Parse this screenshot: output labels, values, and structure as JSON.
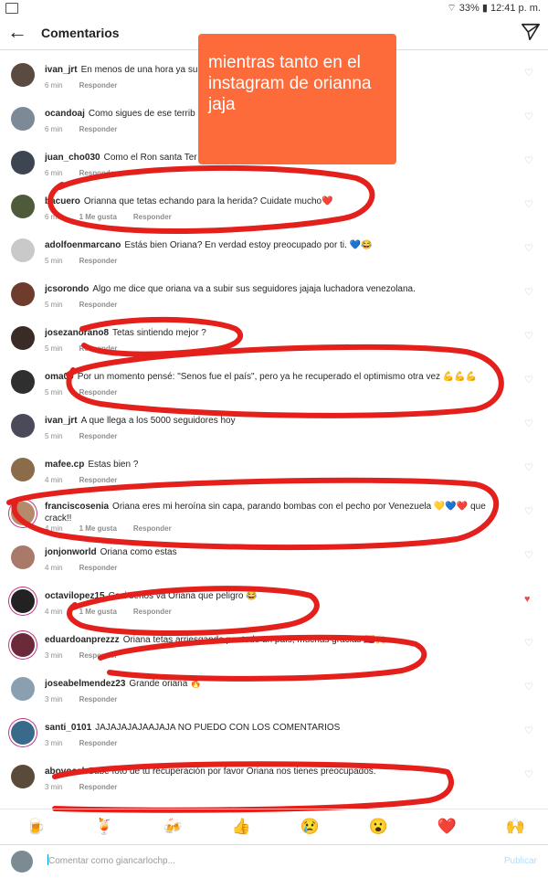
{
  "status": {
    "battery": "33%",
    "time": "12:41 p. m."
  },
  "header": {
    "title": "Comentarios"
  },
  "overlay_text": "mientras tanto en el instagram de orianna jaja",
  "comments": [
    {
      "user": "ivan_jrt",
      "text": "En menos de una hora ya su",
      "time": "6 min",
      "likes": "",
      "reply": "Responder",
      "liked": false
    },
    {
      "user": "ocandoaj",
      "text": "Como sigues de ese terrib",
      "time": "6 min",
      "likes": "",
      "reply": "Responder",
      "liked": false
    },
    {
      "user": "juan_cho030",
      "text": "Como el Ron santa Ter",
      "time": "6 min",
      "likes": "",
      "reply": "Responder",
      "liked": false
    },
    {
      "user": "bacuero",
      "text": "Orianna que tetas echando para la herida? Cuidate mucho❤️",
      "time": "6 min",
      "likes": "1 Me gusta",
      "reply": "Responder",
      "liked": false
    },
    {
      "user": "adolfoenmarcano",
      "text": "Estás bien Oriana? En verdad estoy preocupado por ti. 💙😂",
      "time": "5 min",
      "likes": "",
      "reply": "Responder",
      "liked": false
    },
    {
      "user": "jcsorondo",
      "text": "Algo me dice que oriana va a subir sus seguidores jajaja luchadora venezolana.",
      "time": "5 min",
      "likes": "",
      "reply": "Responder",
      "liked": false
    },
    {
      "user": "josezanorano8",
      "text": "Tetas sintiendo mejor ?",
      "time": "5 min",
      "likes": "",
      "reply": "Responder",
      "liked": false
    },
    {
      "user": "oma09",
      "text": "Por un momento pensé: \"Senos fue el país\", pero ya he recuperado el optimismo otra vez 💪💪💪",
      "time": "5 min",
      "likes": "",
      "reply": "Responder",
      "liked": false
    },
    {
      "user": "ivan_jrt",
      "text": "A que llega a los 5000 seguidores hoy",
      "time": "5 min",
      "likes": "",
      "reply": "Responder",
      "liked": false
    },
    {
      "user": "mafee.cp",
      "text": "Estas bien ?",
      "time": "4 min",
      "likes": "",
      "reply": "Responder",
      "liked": false
    },
    {
      "user": "franciscosenia",
      "text": "Oriana eres mi heroína sin capa, parando bombas con el pecho por Venezuela 💛💙❤️ que crack!!",
      "time": "4 min",
      "likes": "1 Me gusta",
      "reply": "Responder",
      "liked": false,
      "wrap": true
    },
    {
      "user": "jonjonworld",
      "text": "Oriana como estas",
      "time": "4 min",
      "likes": "",
      "reply": "Responder",
      "liked": false
    },
    {
      "user": "octavilopez15",
      "text": "Casi senos va Oriana que peligro 😂",
      "time": "4 min",
      "likes": "1 Me gusta",
      "reply": "Responder",
      "liked": true
    },
    {
      "user": "eduardoanprezzz",
      "text": "Oriana tetas arriesgando por todo un país, muchas gracias 🇻🇪🙌",
      "time": "3 min",
      "likes": "",
      "reply": "Responder",
      "liked": false
    },
    {
      "user": "joseabelmendez23",
      "text": "Grande oriana 🔥",
      "time": "3 min",
      "likes": "",
      "reply": "Responder",
      "liked": false
    },
    {
      "user": "santi_0101",
      "text": "JAJAJAJAJAAJAJA NO PUEDO CON LOS COMENTARIOS",
      "time": "3 min",
      "likes": "",
      "reply": "Responder",
      "liked": false
    },
    {
      "user": "abovocal",
      "text": "Sube foto de tu recuperación por favor Oriana nos tienes preocupados.",
      "time": "3 min",
      "likes": "",
      "reply": "Responder",
      "liked": false
    }
  ],
  "emoji_bar": [
    "🍺",
    "🍹",
    "🍻",
    "👍",
    "😢",
    "😮",
    "❤️",
    "🙌"
  ],
  "composer": {
    "placeholder": "Comentar como giancarlochp...",
    "post_label": "Publicar"
  },
  "colors": {
    "overlay": "#fe6b3b",
    "scribble": "#e3201c",
    "like": "#ed4956"
  },
  "icons": {
    "back": "back-arrow-icon",
    "send": "send-icon",
    "heart": "heart-icon"
  }
}
